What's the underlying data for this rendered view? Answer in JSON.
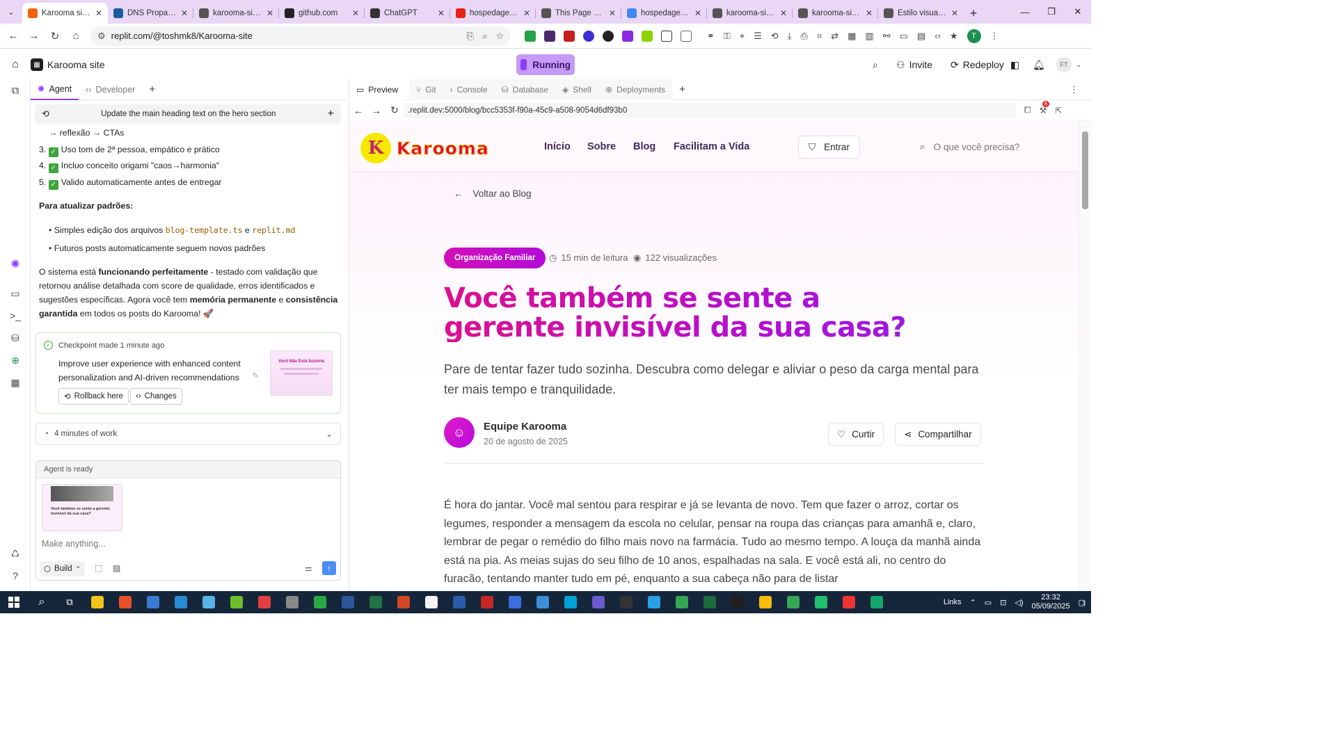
{
  "browser": {
    "tabs": [
      {
        "title": "Karooma site -",
        "color": "#f26207",
        "active": true
      },
      {
        "title": "DNS Propagati",
        "color": "#1a5b9e"
      },
      {
        "title": "karooma-site-t",
        "color": "#555"
      },
      {
        "title": "github.com",
        "color": "#222"
      },
      {
        "title": "ChatGPT",
        "color": "#333"
      },
      {
        "title": "hospedagem n",
        "color": "#e62117"
      },
      {
        "title": "This Page Does",
        "color": "#555"
      },
      {
        "title": "hospedagem n",
        "color": "#4285f4"
      },
      {
        "title": "karooma-site-t",
        "color": "#555"
      },
      {
        "title": "karooma-site-t",
        "color": "#555"
      },
      {
        "title": "Estilo visual pa",
        "color": "#555"
      }
    ],
    "url": "replit.com/@toshmk8/Karooma-site"
  },
  "replit": {
    "project_name": "Karooma site",
    "run_status": "Running",
    "invite": "Invite",
    "redeploy": "Redeploy",
    "avatar_initials": "FT",
    "notification_count": "6"
  },
  "agent_panel": {
    "tabs": {
      "agent": "Agent",
      "developer": "Developer"
    },
    "history_title": "Update the main heading text on the hero section",
    "lines": {
      "l0": "→ reflexão → CTAs",
      "n3": "3.",
      "t3": "Uso tom de 2ª pessoa, empático e prático",
      "n4": "4.",
      "t4": "Incluo conceito origami \"caos→harmonia\"",
      "n5": "5.",
      "t5": "Valido automaticamente antes de entregar"
    },
    "update_heading": "Para atualizar padrões:",
    "bullet1_pre": "Simples edição dos arquivos",
    "bullet1_code1": "blog-template.ts",
    "bullet1_mid": "e",
    "bullet1_code2": "replit.md",
    "bullet2": "Futuros posts automaticamente seguem novos padrões",
    "para": {
      "p1": "O sistema está ",
      "b1": "funcionando perfeitamente",
      "p2": " - testado com validação que retornou análise detalhada com score de qualidade, erros identificados e sugestões específicas. Agora você tem ",
      "b2": "memória permanente",
      "p3": " e ",
      "b3": "consistência garantida",
      "p4": " em todos os posts do Karooma! 🚀"
    },
    "checkpoint": {
      "title": "Checkpoint made 1 minute ago",
      "desc": "Improve user experience with enhanced content personalization and AI-driven recommendations",
      "thumb_text": "Você Não Está Sozinha",
      "rollback": "Rollback here",
      "changes": "Changes"
    },
    "work_summary": "4 minutes of work",
    "status": "Agent is ready",
    "attachment_title": "Você também se sente a gerente invisível da sua casa?",
    "input_placeholder": "Make anything...",
    "build_mode": "Build"
  },
  "preview": {
    "tabs": {
      "preview": "Preview",
      "git": "Git",
      "console": "Console",
      "database": "Database",
      "shell": "Shell",
      "deployments": "Deployments"
    },
    "url": ".replit.dev:5000/blog/bcc5353f-f90a-45c9-a508-9054d6df93b0",
    "badge_count": "6"
  },
  "site": {
    "logo_text": "Karooma",
    "logo_letter": "K",
    "nav": [
      "Início",
      "Sobre",
      "Blog",
      "Facilitam a Vida"
    ],
    "login": "Entrar",
    "search_placeholder": "O que você precisa?",
    "back_link": "Voltar ao Blog",
    "category": "Organização Familiar",
    "read_time": "15 min de leitura",
    "views": "122 visualizações",
    "title": "Você também se sente a gerente invisível da sua casa?",
    "subtitle": "Pare de tentar fazer tudo sozinha. Descubra como delegar e aliviar o peso da carga mental para ter mais tempo e tranquilidade.",
    "author": "Equipe Karooma",
    "date": "20 de agosto de 2025",
    "like": "Curtir",
    "share": "Compartilhar",
    "body": "É hora do jantar. Você mal sentou para respirar e já se levanta de novo. Tem que fazer o arroz, cortar os legumes, responder a mensagem da escola no celular, pensar na roupa das crianças para amanhã e, claro, lembrar de pegar o remédio do filho mais novo na farmácia. Tudo ao mesmo tempo. A louça da manhã ainda está na pia. As meias sujas do seu filho de 10 anos, espalhadas na sala. E você está ali, no centro do furacão, tentando manter tudo em pé, enquanto a sua cabeça não para de listar"
  },
  "taskbar": {
    "links_label": "Links",
    "time": "23:32",
    "date": "05/09/2025",
    "notif": "3"
  },
  "colors": {
    "accent": "#8b3dff",
    "brand_pink": "#d20fb8",
    "run_bg": "#c59bf7",
    "taskbar": "#16263a",
    "tabstrip": "#e9d7f5"
  }
}
